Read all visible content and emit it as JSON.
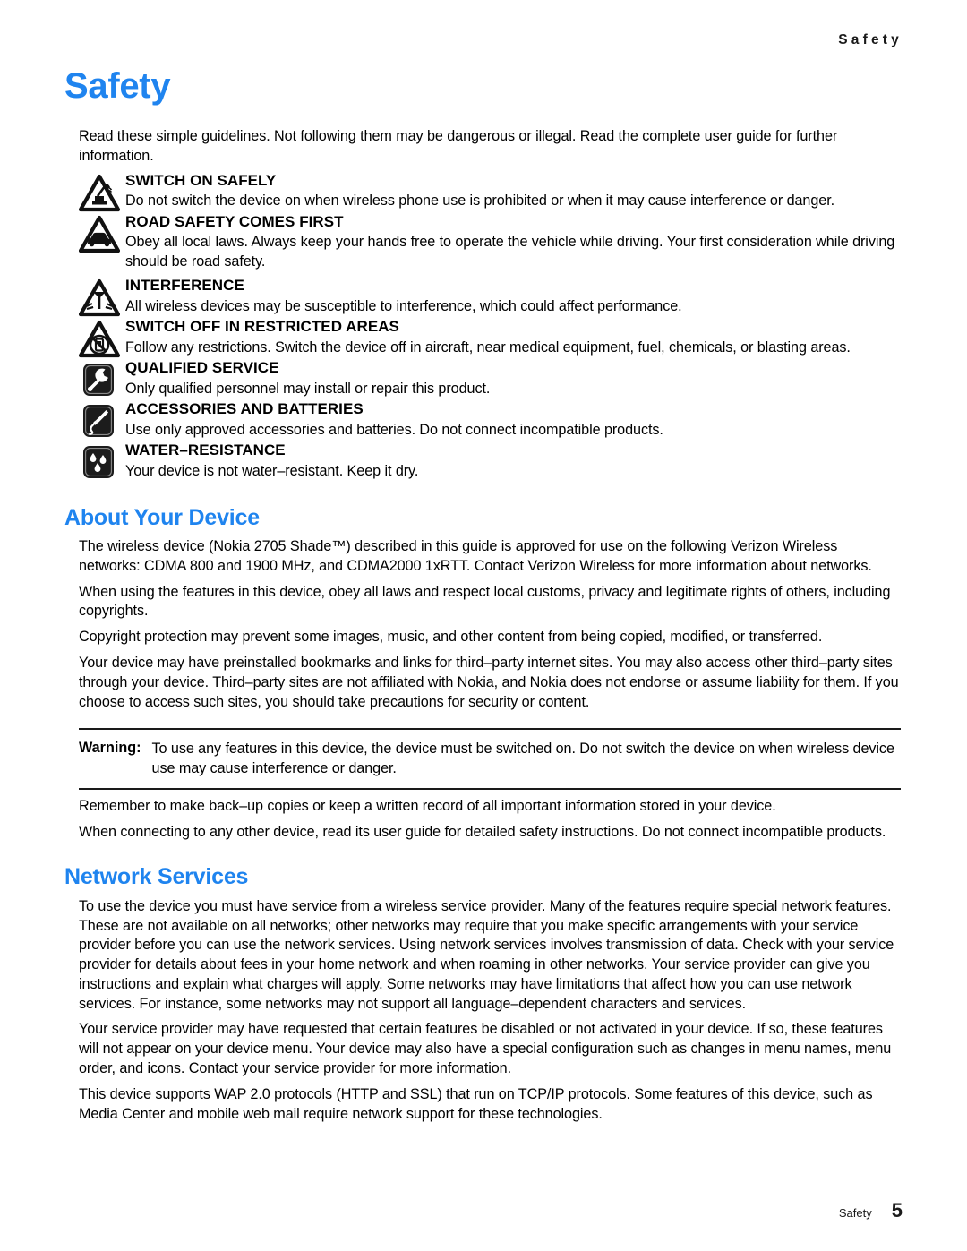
{
  "header": {
    "running_title": "Safety"
  },
  "chapter": {
    "title": "Safety",
    "intro": "Read these simple guidelines. Not following them may be dangerous or illegal. Read the complete user guide for further information."
  },
  "guidelines": [
    {
      "icon": "switch-on-safely-triangle-icon",
      "heading": "SWITCH ON SAFELY",
      "text": "Do not switch the device on when wireless phone use is prohibited or when it may cause interference or danger."
    },
    {
      "icon": "road-safety-car-triangle-icon",
      "heading": "ROAD SAFETY COMES FIRST",
      "text": "Obey all local laws. Always keep your hands free to operate the vehicle while driving. Your first consideration while driving should be road safety."
    },
    {
      "icon": "interference-antenna-triangle-icon",
      "heading": "INTERFERENCE",
      "text": "All wireless devices may be susceptible to interference, which could affect performance."
    },
    {
      "icon": "switch-off-restricted-triangle-icon",
      "heading": "SWITCH OFF IN RESTRICTED AREAS",
      "text": "Follow any restrictions. Switch the device off in aircraft, near medical equipment, fuel, chemicals, or blasting areas."
    },
    {
      "icon": "qualified-service-wrench-icon",
      "heading": "QUALIFIED SERVICE",
      "text": "Only qualified personnel may install or repair this product."
    },
    {
      "icon": "accessories-batteries-connector-icon",
      "heading": "ACCESSORIES AND BATTERIES",
      "text": "Use only approved accessories and batteries. Do not connect incompatible products."
    },
    {
      "icon": "water-resistance-droplets-icon",
      "heading": "WATER–RESISTANCE",
      "text": "Your device is not water–resistant. Keep it dry."
    }
  ],
  "about_your_device": {
    "title": "About Your Device",
    "paragraphs": [
      "The wireless device (Nokia 2705 Shade™) described in this guide is approved for use on the following Verizon Wireless networks: CDMA 800 and 1900 MHz, and CDMA2000 1xRTT. Contact Verizon Wireless for more information about networks.",
      "When using the features in this device, obey all laws and respect local customs, privacy and legitimate rights of others, including copyrights.",
      "Copyright protection may prevent some images, music, and other content from being copied, modified, or transferred.",
      "Your device may have preinstalled bookmarks and links for third–party internet sites. You may also access other third–party sites through your device. Third–party sites are not affiliated with Nokia, and Nokia does not endorse or assume liability for them. If you choose to access such sites, you should take precautions for security or content."
    ],
    "warning": {
      "label": "Warning:",
      "text": "To use any features in this device, the device must be switched on. Do not switch the device on when wireless device use may cause interference or danger."
    },
    "paragraphs_after_warning": [
      "Remember to make back–up copies or keep a written record of all important information stored in your device.",
      "When connecting to any other device, read its user guide for detailed safety instructions. Do not connect incompatible products."
    ]
  },
  "network_services": {
    "title": "Network Services",
    "paragraphs": [
      "To use the device you must have service from a wireless service provider. Many of the features require special network features. These are not available on all networks; other networks may require that you make specific arrangements with your service provider before you can use the network services. Using network services involves transmission of data. Check with your service provider for details about fees in your home network and when roaming in other networks. Your service provider can give you instructions and explain what charges will apply. Some networks may have limitations that affect how you can use network services. For instance, some networks may not support all language–dependent characters and services.",
      "Your service provider may have requested that certain features be disabled or not activated in your device. If so, these features will not appear on your device menu. Your device may also have a special configuration such as changes in menu names, menu order, and icons. Contact your service provider for more information.",
      "This device supports WAP 2.0 protocols (HTTP and SSL) that run on TCP/IP protocols. Some features of this device, such as Media Center and mobile web mail require network support for these technologies."
    ]
  },
  "footer": {
    "label": "Safety",
    "page_number": "5"
  },
  "colors": {
    "heading_blue": "#1f84ef",
    "body_black": "#000000",
    "icon_dark": "#1c1c1c"
  }
}
